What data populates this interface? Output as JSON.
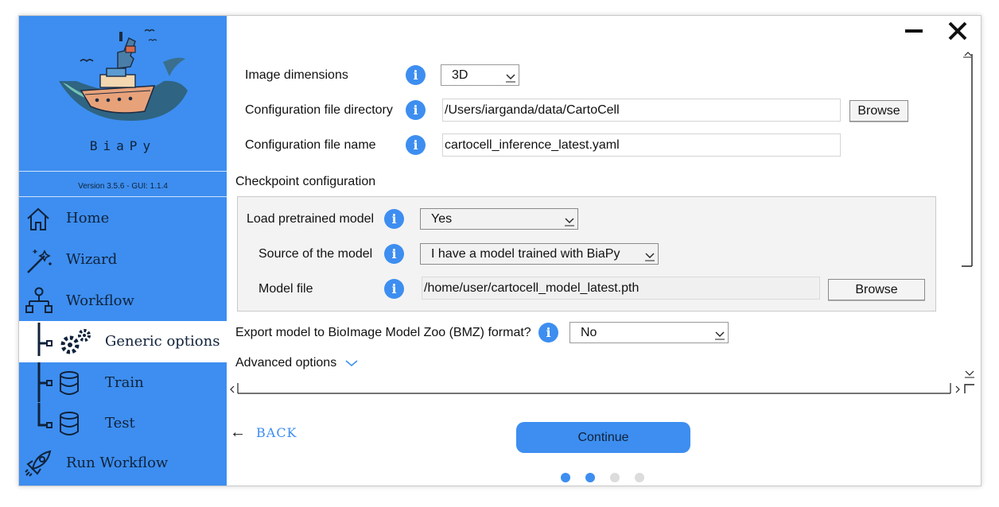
{
  "app": {
    "name": "BiaPy",
    "version": "Version 3.5.6 - GUI: 1.1.4"
  },
  "sidebar": {
    "items": [
      {
        "label": "Home",
        "icon": "home-icon"
      },
      {
        "label": "Wizard",
        "icon": "magic-wand-icon"
      },
      {
        "label": "Workflow",
        "icon": "workflow-icon"
      },
      {
        "label": "Generic options",
        "icon": "gears-icon",
        "active": true
      },
      {
        "label": "Train",
        "icon": "database-icon"
      },
      {
        "label": "Test",
        "icon": "database-icon"
      },
      {
        "label": "Run Workflow",
        "icon": "rocket-icon"
      }
    ]
  },
  "form": {
    "image_dimensions": {
      "label": "Image dimensions",
      "value": "3D"
    },
    "config_dir": {
      "label": "Configuration file directory",
      "value": "/Users/iarganda/data/CartoCell",
      "button": "Browse"
    },
    "config_name": {
      "label": "Configuration file name",
      "value": "cartocell_inference_latest.yaml"
    },
    "checkpoint_title": "Checkpoint configuration",
    "load_pretrained": {
      "label": "Load pretrained model",
      "value": "Yes"
    },
    "source_model": {
      "label": "Source of the model",
      "value": "I have a model trained with BiaPy"
    },
    "model_file": {
      "label": "Model file",
      "value": "/home/user/cartocell_model_latest.pth",
      "button": "Browse"
    },
    "export_bmz": {
      "label": "Export model to BioImage Model Zoo (BMZ) format?",
      "value": "No"
    },
    "advanced": {
      "label": "Advanced options"
    }
  },
  "footer": {
    "back_label": "BACK",
    "continue_label": "Continue",
    "pages": [
      {
        "state": "active"
      },
      {
        "state": "active"
      },
      {
        "state": "inactive"
      },
      {
        "state": "inactive"
      }
    ]
  },
  "colors": {
    "accent": "#3d8ef0",
    "dot_active": "#3d8ef0",
    "dot_inactive": "#dcdcdc"
  }
}
